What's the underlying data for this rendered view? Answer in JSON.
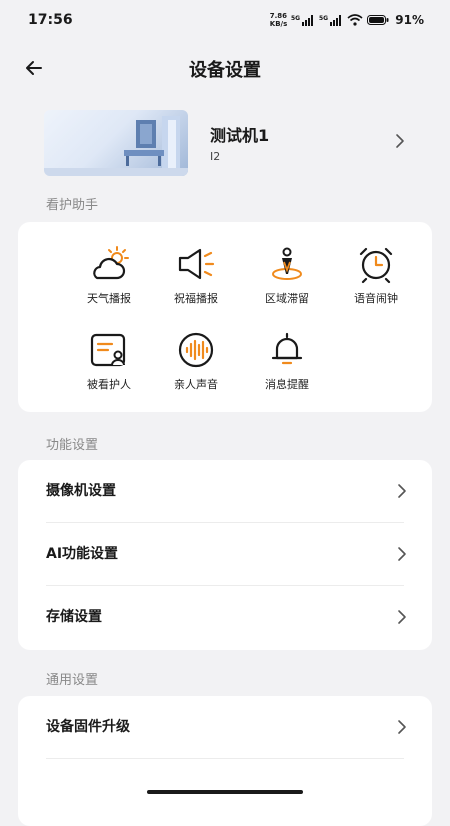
{
  "status_bar": {
    "time": "17:56",
    "net_speed_value": "7.86",
    "net_speed_unit": "KB/s",
    "battery_pct": "91%"
  },
  "nav": {
    "title": "设备设置"
  },
  "device": {
    "name": "测试机1",
    "id": "I2"
  },
  "assistant": {
    "section_label": "看护助手",
    "items": [
      {
        "label": "天气播报",
        "icon": "weather-icon"
      },
      {
        "label": "祝福播报",
        "icon": "speaker-icon"
      },
      {
        "label": "区域滞留",
        "icon": "area-icon"
      },
      {
        "label": "语音闹钟",
        "icon": "alarm-clock-icon"
      },
      {
        "label": "被看护人",
        "icon": "profile-card-icon"
      },
      {
        "label": "亲人声音",
        "icon": "voice-wave-icon"
      },
      {
        "label": "消息提醒",
        "icon": "bell-icon"
      }
    ]
  },
  "function_settings": {
    "section_label": "功能设置",
    "rows": [
      {
        "label": "摄像机设置"
      },
      {
        "label": "AI功能设置"
      },
      {
        "label": "存储设置"
      }
    ]
  },
  "general_settings": {
    "section_label": "通用设置",
    "rows": [
      {
        "label": "设备固件升级"
      }
    ]
  },
  "colors": {
    "accent": "#f08a1c",
    "background": "#f2f2f4",
    "card": "#ffffff"
  }
}
